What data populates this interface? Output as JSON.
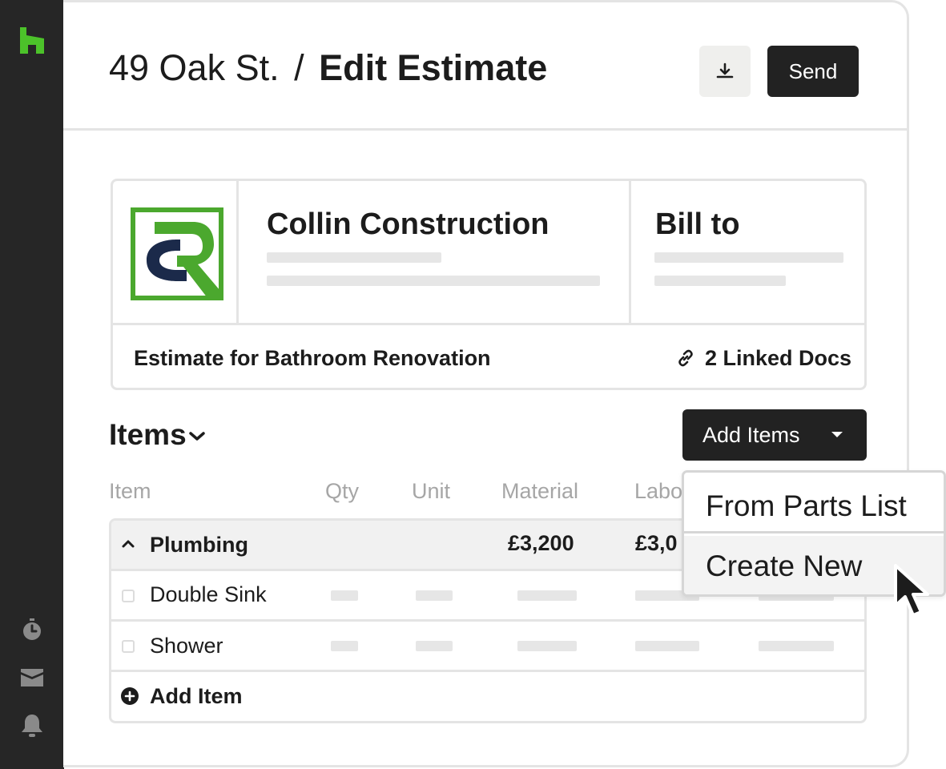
{
  "header": {
    "crumb": "49 Oak St.",
    "separator": "/",
    "title": "Edit Estimate",
    "send_label": "Send",
    "download_icon": "download-icon"
  },
  "company": {
    "name": "Collin Construction",
    "logo": "cr-logo",
    "bill_to_label": "Bill to"
  },
  "estimate": {
    "description": "Estimate for Bathroom Renovation",
    "linked_docs": "2 Linked Docs"
  },
  "items": {
    "title": "Items",
    "add_items_label": "Add Items",
    "columns": [
      "Item",
      "Qty",
      "Unit",
      "Material",
      "Labo"
    ],
    "group": {
      "name": "Plumbing",
      "material": "£3,200",
      "labor": "£3,0"
    },
    "rows": [
      {
        "name": "Double Sink"
      },
      {
        "name": "Shower"
      }
    ],
    "add_item_label": "Add Item"
  },
  "dropdown": {
    "options": [
      "From Parts List",
      "Create New"
    ],
    "hovered": "Create New"
  },
  "colors": {
    "sidebar": "#262626",
    "accent_green": "#4ba82e",
    "navy": "#1b2a4a",
    "dark_button": "#222222"
  }
}
